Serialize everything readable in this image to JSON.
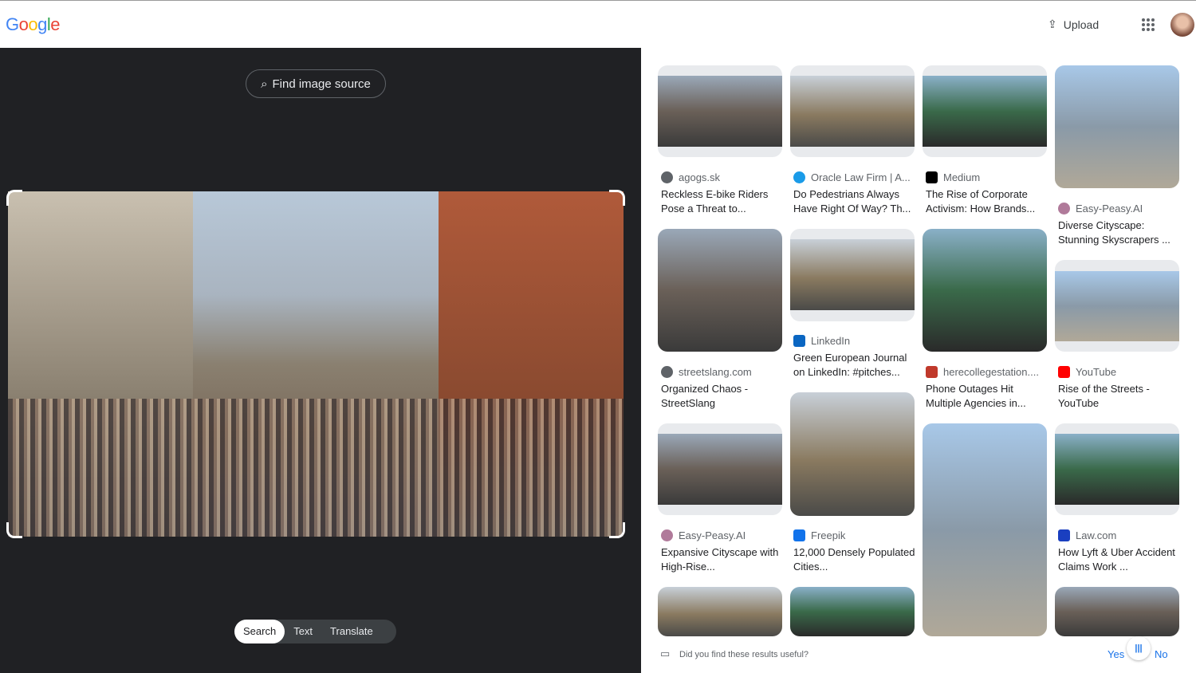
{
  "header": {
    "logo": "Google",
    "upload_label": "Upload"
  },
  "left": {
    "find_source_label": "Find image source",
    "tabs": [
      "Search",
      "Text",
      "Translate"
    ],
    "active_tab": "Search"
  },
  "results": [
    {
      "source": "agogs.sk",
      "title": "Reckless E-bike Riders Pose a Threat to...",
      "icon": "globe-icon",
      "color": "#5f6368"
    },
    {
      "source": "Oracle Law Firm | A...",
      "title": "Do Pedestrians Always Have Right Of Way? Th...",
      "icon": "oracle-icon",
      "color": "#1a9be8"
    },
    {
      "source": "Medium",
      "title": "The Rise of Corporate Activism: How Brands...",
      "icon": "medium-icon",
      "color": "#000000"
    },
    {
      "source": "Easy-Peasy.AI",
      "title": "Diverse Cityscape: Stunning Skyscrapers ...",
      "icon": "easy-peasy-icon",
      "color": "#b07a9a"
    },
    {
      "source": "streetslang.com",
      "title": "Organized Chaos - StreetSlang",
      "icon": "globe-icon",
      "color": "#5f6368"
    },
    {
      "source": "LinkedIn",
      "title": "Green European Journal on LinkedIn: #pitches...",
      "icon": "linkedin-icon",
      "color": "#0a66c2"
    },
    {
      "source": "herecollegestation....",
      "title": "Phone Outages Hit Multiple Agencies in...",
      "icon": "herecollegestation-icon",
      "color": "#c0392b"
    },
    {
      "source": "YouTube",
      "title": "Rise of the Streets - YouTube",
      "icon": "youtube-icon",
      "color": "#ff0000"
    },
    {
      "source": "Easy-Peasy.AI",
      "title": "Expansive Cityscape with High-Rise...",
      "icon": "easy-peasy-icon",
      "color": "#b07a9a"
    },
    {
      "source": "Freepik",
      "title": "12,000 Densely Populated Cities...",
      "icon": "freepik-icon",
      "color": "#1273eb"
    },
    {
      "source": "Law.com",
      "title": "How Lyft & Uber Accident Claims Work ...",
      "icon": "lawcom-icon",
      "color": "#1a3fc0"
    }
  ],
  "feedback": {
    "question": "Did you find these results useful?",
    "yes": "Yes",
    "no": "No"
  }
}
